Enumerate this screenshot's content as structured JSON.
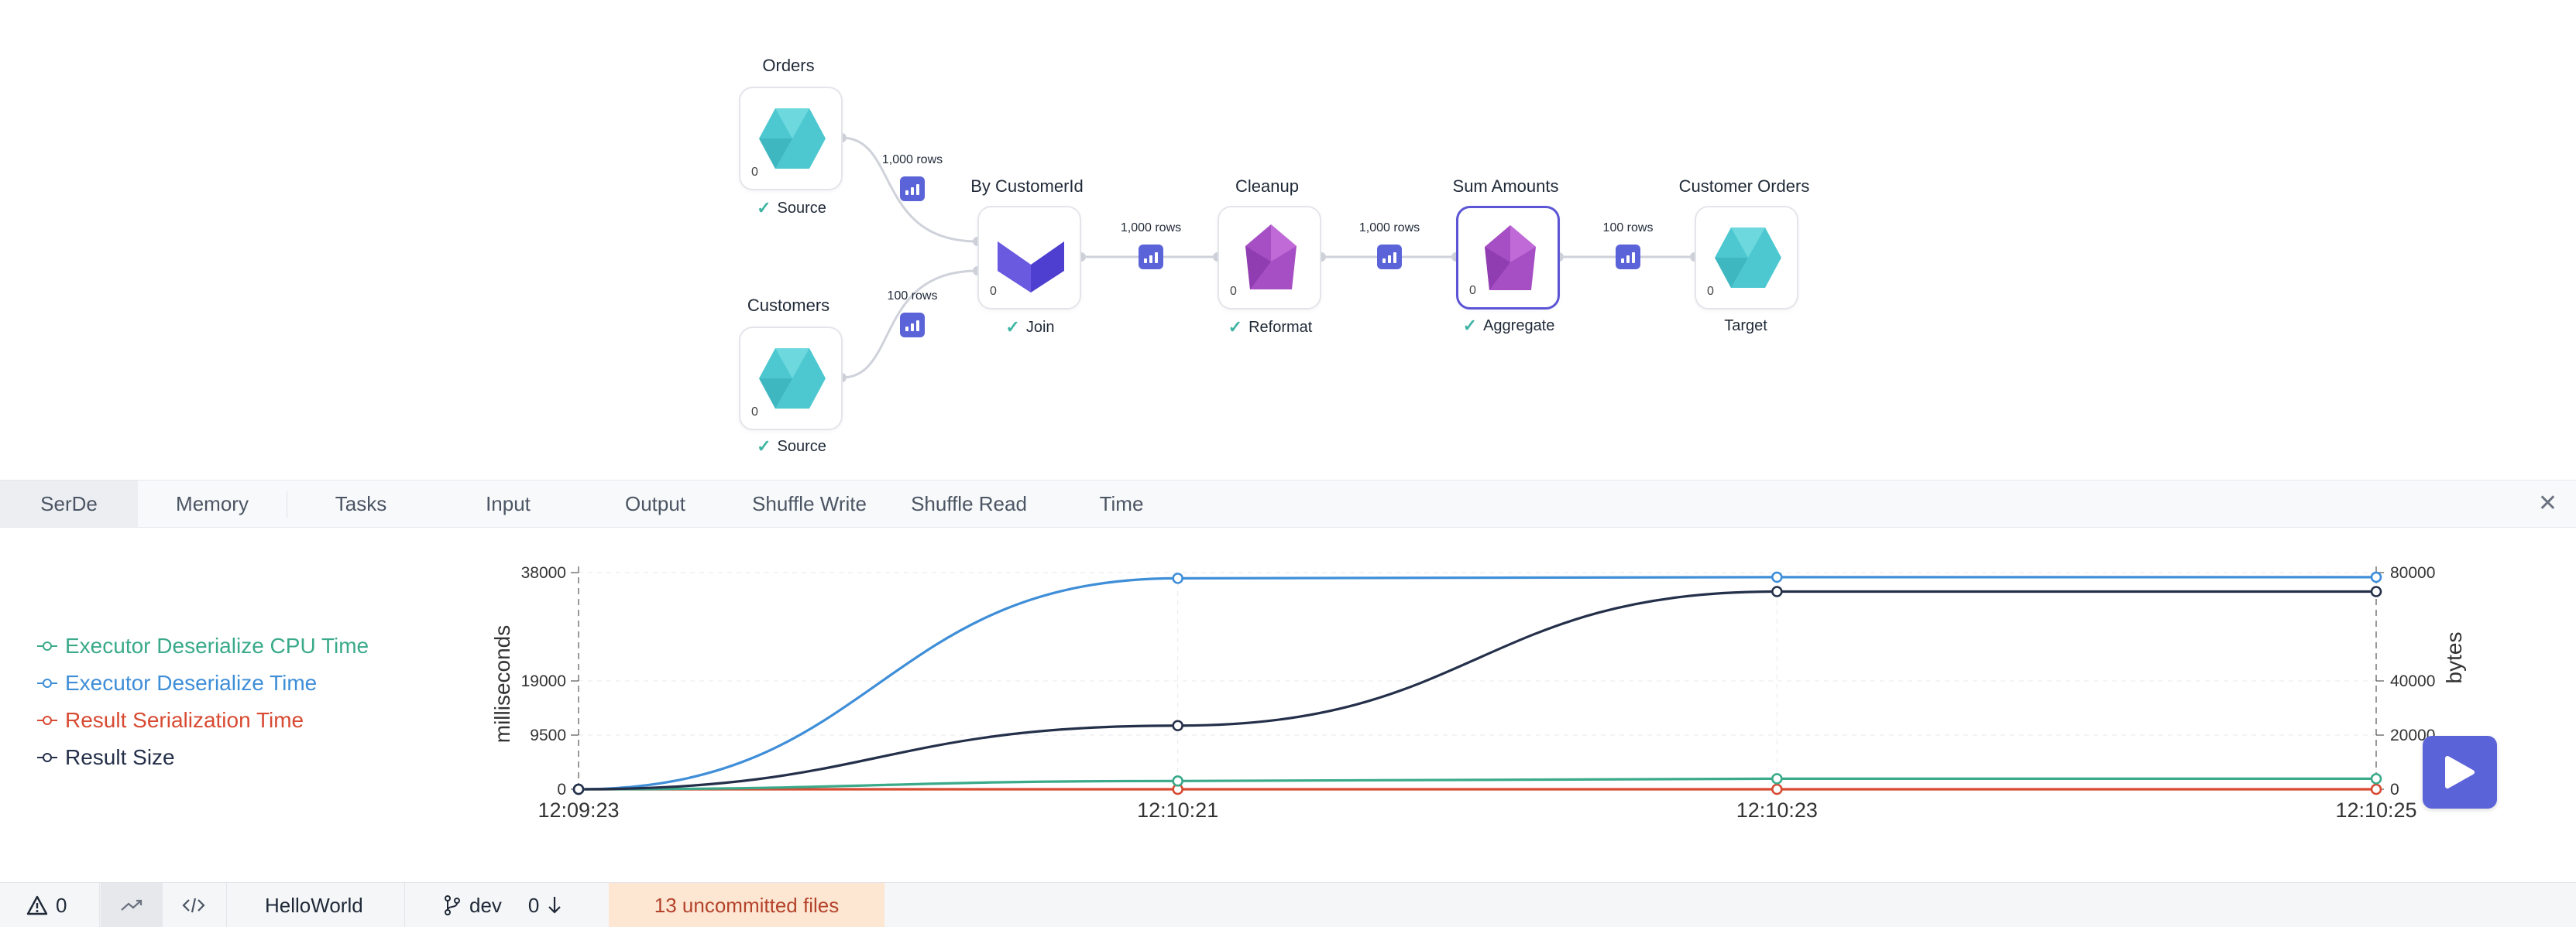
{
  "pipeline": {
    "nodes": [
      {
        "id": "orders",
        "title": "Orders",
        "count": "0",
        "status": "Source",
        "checked": true,
        "shape": "hexagon",
        "color": "#4dc8d0"
      },
      {
        "id": "customers",
        "title": "Customers",
        "count": "0",
        "status": "Source",
        "checked": true,
        "shape": "hexagon",
        "color": "#4dc8d0"
      },
      {
        "id": "join",
        "title": "By CustomerId",
        "count": "0",
        "status": "Join",
        "checked": true,
        "shape": "join",
        "color": "#4f3fd0"
      },
      {
        "id": "cleanup",
        "title": "Cleanup",
        "count": "0",
        "status": "Reformat",
        "checked": true,
        "shape": "gem",
        "color": "#a64fc4"
      },
      {
        "id": "sum",
        "title": "Sum Amounts",
        "count": "0",
        "status": "Aggregate",
        "checked": true,
        "shape": "gem",
        "color": "#a64fc4",
        "selected": true
      },
      {
        "id": "target",
        "title": "Customer Orders",
        "count": "0",
        "status": "Target",
        "checked": false,
        "shape": "hexagon",
        "color": "#4dc8d0"
      }
    ],
    "edges": [
      {
        "from": "orders",
        "to": "join",
        "label": "1,000 rows"
      },
      {
        "from": "customers",
        "to": "join",
        "label": "100 rows"
      },
      {
        "from": "join",
        "to": "cleanup",
        "label": "1,000 rows"
      },
      {
        "from": "cleanup",
        "to": "sum",
        "label": "1,000 rows"
      },
      {
        "from": "sum",
        "to": "target",
        "label": "100 rows"
      }
    ]
  },
  "tabs": [
    {
      "label": "SerDe",
      "active": true
    },
    {
      "label": "Memory"
    },
    {
      "label": "Tasks"
    },
    {
      "label": "Input"
    },
    {
      "label": "Output"
    },
    {
      "label": "Shuffle Write"
    },
    {
      "label": "Shuffle Read"
    },
    {
      "label": "Time"
    }
  ],
  "close_icon": "close-icon",
  "legend": [
    {
      "label": "Executor Deserialize CPU Time",
      "color": "#3aaa8a"
    },
    {
      "label": "Executor Deserialize Time",
      "color": "#3f8ed8"
    },
    {
      "label": "Result Serialization Time",
      "color": "#d84a32"
    },
    {
      "label": "Result Size",
      "color": "#24304a"
    }
  ],
  "chart_data": {
    "type": "line",
    "x": [
      "12:09:23",
      "12:10:21",
      "12:10:23",
      "12:10:25"
    ],
    "left_axis": {
      "label": "milliseconds",
      "ticks": [
        "0",
        "9500",
        "19000",
        "38000"
      ],
      "range": [
        0,
        38000
      ]
    },
    "right_axis": {
      "label": "bytes",
      "ticks": [
        "0",
        "20000",
        "40000",
        "80000"
      ],
      "range": [
        0,
        80000
      ]
    },
    "grid": true,
    "series": [
      {
        "name": "Executor Deserialize CPU Time",
        "axis": "left",
        "values": [
          0,
          1450,
          1850,
          1850
        ],
        "color": "#3aaa8a"
      },
      {
        "name": "Executor Deserialize Time",
        "axis": "left",
        "values": [
          0,
          37000,
          37200,
          37200
        ],
        "color": "#3f8ed8"
      },
      {
        "name": "Result Serialization Time",
        "axis": "left",
        "values": [
          0,
          0,
          0,
          0
        ],
        "color": "#d84a32"
      },
      {
        "name": "Result Size",
        "axis": "right",
        "values": [
          0,
          23500,
          73000,
          73000
        ],
        "color": "#24304a"
      }
    ]
  },
  "run_button_icon": "play-icon",
  "statusbar": {
    "warnings": "0",
    "project": "HelloWorld",
    "branch": "dev",
    "behind": "0",
    "uncommitted": "13 uncommitted files"
  }
}
